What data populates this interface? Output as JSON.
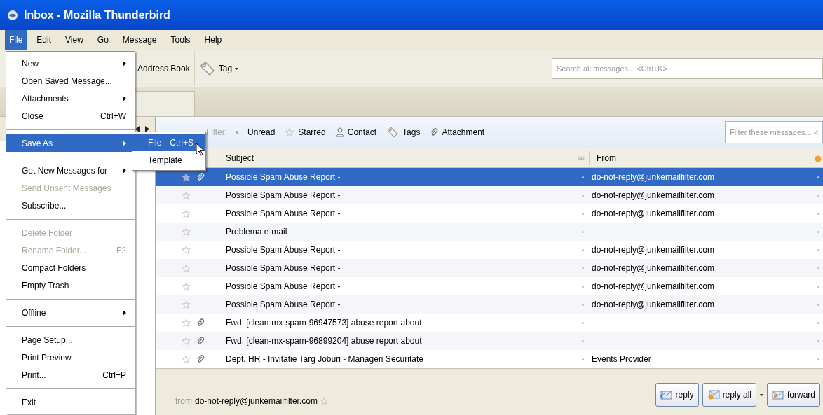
{
  "window": {
    "title": "Inbox - Mozilla Thunderbird"
  },
  "menubar": [
    {
      "label": "File",
      "selected": true
    },
    {
      "label": "Edit",
      "selected": false
    },
    {
      "label": "View",
      "selected": false
    },
    {
      "label": "Go",
      "selected": false
    },
    {
      "label": "Message",
      "selected": false
    },
    {
      "label": "Tools",
      "selected": false
    },
    {
      "label": "Help",
      "selected": false
    }
  ],
  "toolbar": {
    "buttons": [
      {
        "label": "Address Book",
        "kind": "book"
      },
      {
        "label": "Tag",
        "kind": "tag"
      }
    ],
    "search": {
      "placeholder": "Search all messages... <Ctrl+K>"
    }
  },
  "quick_filter": {
    "label": "Filter:",
    "buttons": [
      {
        "label": "Unread",
        "kind": "unread"
      },
      {
        "label": "Starred",
        "kind": "starred"
      },
      {
        "label": "Contact",
        "kind": "contact"
      },
      {
        "label": "Tags",
        "kind": "tags"
      },
      {
        "label": "Attachment",
        "kind": "attachment"
      }
    ],
    "field": {
      "placeholder": "Filter these messages... <"
    }
  },
  "table": {
    "columns": [
      "Subject",
      "From"
    ],
    "rows": [
      {
        "subject": "Possible Spam Abuse Report -",
        "from": "do-not-reply@junkemailfilter.com",
        "selected": true,
        "attachment": true
      },
      {
        "subject": "Possible Spam Abuse Report -",
        "from": "do-not-reply@junkemailfilter.com",
        "selected": false,
        "attachment": false
      },
      {
        "subject": "Possible Spam Abuse Report -",
        "from": "do-not-reply@junkemailfilter.com",
        "selected": false,
        "attachment": false
      },
      {
        "subject": "Problema e-mail",
        "selected": false,
        "attachment": false
      },
      {
        "subject": "Possible Spam Abuse Report -",
        "from": "do-not-reply@junkemailfilter.com",
        "selected": false,
        "attachment": false
      },
      {
        "subject": "Possible Spam Abuse Report -",
        "from": "do-not-reply@junkemailfilter.com",
        "selected": false,
        "attachment": false
      },
      {
        "subject": "Possible Spam Abuse Report -",
        "from": "do-not-reply@junkemailfilter.com",
        "selected": false,
        "attachment": false
      },
      {
        "subject": "Possible Spam Abuse Report -",
        "from": "do-not-reply@junkemailfilter.com",
        "selected": false,
        "attachment": false
      },
      {
        "subject": "Fwd: [clean-mx-spam-96947573] abuse report about",
        "selected": false,
        "attachment": true
      },
      {
        "subject": "Fwd: [clean-mx-spam-96899204] abuse report about",
        "selected": false,
        "attachment": true
      },
      {
        "subject": "Dept. HR - Invitatie Targ Joburi - Manageri Securitate",
        "from": "Events Provider",
        "selected": false,
        "attachment": true
      }
    ]
  },
  "preview": {
    "from_label": "from",
    "from": "do-not-reply@junkemailfilter.com",
    "buttons": [
      {
        "label": "reply",
        "kind": "reply"
      },
      {
        "label": "reply all",
        "kind": "replyall"
      },
      {
        "label": "forward",
        "kind": "forward"
      }
    ]
  },
  "file_menu": [
    {
      "kind": "item",
      "label": "New",
      "submenu": true,
      "disabled": false,
      "selected": false
    },
    {
      "kind": "item",
      "label": "Open Saved Message...",
      "submenu": false,
      "disabled": false,
      "selected": false
    },
    {
      "kind": "item",
      "label": "Attachments",
      "submenu": true,
      "disabled": false,
      "selected": false
    },
    {
      "kind": "item",
      "label": "Close",
      "shortcut": "Ctrl+W",
      "submenu": false,
      "disabled": false,
      "selected": false
    },
    {
      "kind": "separator"
    },
    {
      "kind": "item",
      "label": "Save As",
      "submenu": true,
      "disabled": false,
      "selected": true
    },
    {
      "kind": "separator"
    },
    {
      "kind": "item",
      "label": "Get New Messages for",
      "submenu": true,
      "disabled": false,
      "selected": false
    },
    {
      "kind": "item",
      "label": "Send Unsent Messages",
      "submenu": false,
      "disabled": true,
      "selected": false
    },
    {
      "kind": "item",
      "label": "Subscribe...",
      "submenu": false,
      "disabled": false,
      "selected": false
    },
    {
      "kind": "separator"
    },
    {
      "kind": "item",
      "label": "Delete Folder",
      "submenu": false,
      "disabled": true,
      "selected": false
    },
    {
      "kind": "item",
      "label": "Rename Folder...",
      "shortcut": "F2",
      "submenu": false,
      "disabled": true,
      "selected": false
    },
    {
      "kind": "item",
      "label": "Compact Folders",
      "submenu": false,
      "disabled": false,
      "selected": false
    },
    {
      "kind": "item",
      "label": "Empty Trash",
      "submenu": false,
      "disabled": false,
      "selected": false
    },
    {
      "kind": "separator"
    },
    {
      "kind": "item",
      "label": "Offline",
      "submenu": true,
      "disabled": false,
      "selected": false
    },
    {
      "kind": "separator"
    },
    {
      "kind": "item",
      "label": "Page Setup...",
      "submenu": false,
      "disabled": false,
      "selected": false
    },
    {
      "kind": "item",
      "label": "Print Preview",
      "submenu": false,
      "disabled": false,
      "selected": false
    },
    {
      "kind": "item",
      "label": "Print...",
      "shortcut": "Ctrl+P",
      "submenu": false,
      "disabled": false,
      "selected": false
    },
    {
      "kind": "separator"
    },
    {
      "kind": "item",
      "label": "Exit",
      "submenu": false,
      "disabled": false,
      "selected": false
    }
  ],
  "save_as_menu": [
    {
      "label": "File",
      "shortcut": "Ctrl+S",
      "selected": true
    },
    {
      "label": "Template",
      "selected": false
    }
  ]
}
